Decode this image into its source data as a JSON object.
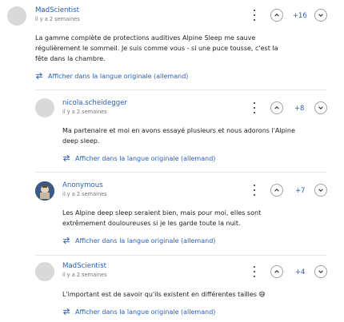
{
  "icons": {
    "more": "more-vertical-icon",
    "upvote": "chevron-up-icon",
    "downvote": "chevron-down-icon",
    "translate": "translate-arrows-icon"
  },
  "colors": {
    "accent": "#2a5fb0",
    "text": "#222222",
    "meta": "#777777"
  },
  "comments": [
    {
      "author": "MadScientist",
      "time": "il y a 2 semaines",
      "score": "+16",
      "body": "La gamme complète de protections auditives Alpine Sleep me sauve régulièrement le sommeil. Je suis comme vous - si une puce tousse, c'est la fête dans la chambre.",
      "translate": "Afficher dans la langue originale (allemand)"
    },
    {
      "author": "nicola.scheidegger",
      "time": "il y a 2 semaines",
      "score": "+8",
      "body": "Ma partenaire et moi en avons essayé plusieurs et nous adorons l'Alpine deep sleep.",
      "translate": "Afficher dans la langue originale (allemand)"
    },
    {
      "author": "Anonymous",
      "time": "il y a 2 semaines",
      "score": "+7",
      "body": "Les Alpine deep sleep seraient bien, mais pour moi, elles sont extrêmement douloureuses si je les garde toute la nuit.",
      "translate": "Afficher dans la langue originale (allemand)"
    },
    {
      "author": "MadScientist",
      "time": "il y a 2 semaines",
      "score": "+4",
      "body": "L'important est de savoir qu'ils existent en différentes tailles",
      "emoji": "😄",
      "translate": "Afficher dans la langue originale (allemand)"
    }
  ]
}
